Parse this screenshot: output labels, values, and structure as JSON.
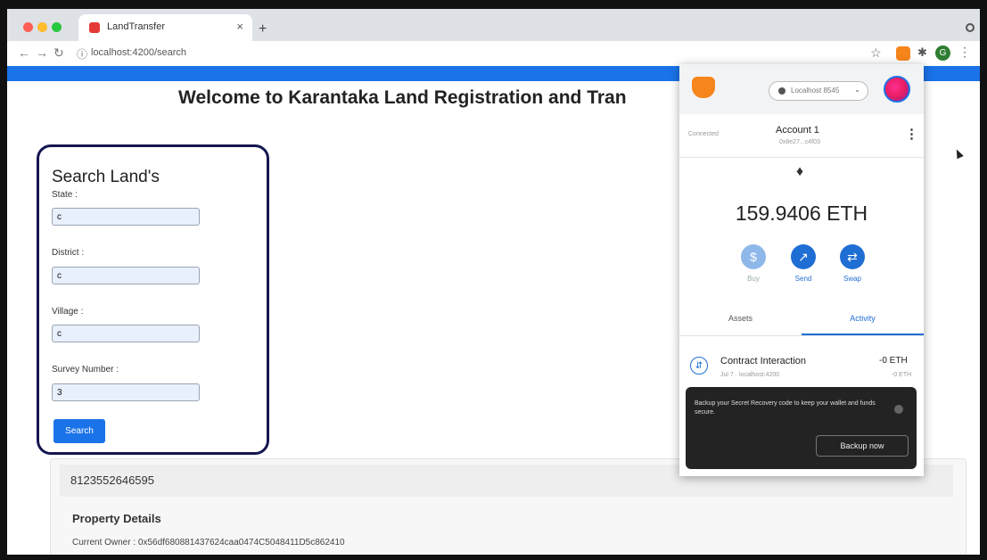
{
  "browser": {
    "tab_title": "LandTransfer",
    "tab_close": "×",
    "new_tab": "+",
    "url": "localhost:4200/search",
    "profile_initial": "G"
  },
  "page": {
    "title": "Welcome to Karantaka Land Registration and Tran"
  },
  "search_form": {
    "heading": "Search Land's",
    "state_label": "State :",
    "state_value": "c",
    "district_label": "District :",
    "district_value": "c",
    "village_label": "Village :",
    "village_value": "c",
    "survey_label": "Survey Number :",
    "survey_value": "3",
    "button_label": "Search"
  },
  "result": {
    "number": "8123552646595",
    "property_heading": "Property Details",
    "current_owner": "Current Owner : 0x56df680881437624caa0474C5048411D5c862410"
  },
  "metamask": {
    "network": "Localhost 8545",
    "connected": "Connected",
    "account_name": "Account 1",
    "account_address": "0x8e27...c4f03",
    "balance": "159.9406 ETH",
    "actions": {
      "buy": "Buy",
      "send": "Send",
      "swap": "Swap"
    },
    "tabs": {
      "assets": "Assets",
      "activity": "Activity"
    },
    "transaction": {
      "title": "Contract Interaction",
      "subtitle": "Jul 7 · localhost:4200",
      "amount": "-0 ETH",
      "amount_secondary": "-0 ETH"
    },
    "toast": {
      "message": "Backup your Secret Recovery code to keep your wallet and funds secure.",
      "button": "Backup now"
    }
  },
  "colors": {
    "brand_blue": "#1a73e8",
    "card_border": "#141650",
    "metamask_orange": "#f6851b",
    "metamask_blue": "#1f6ed4"
  }
}
